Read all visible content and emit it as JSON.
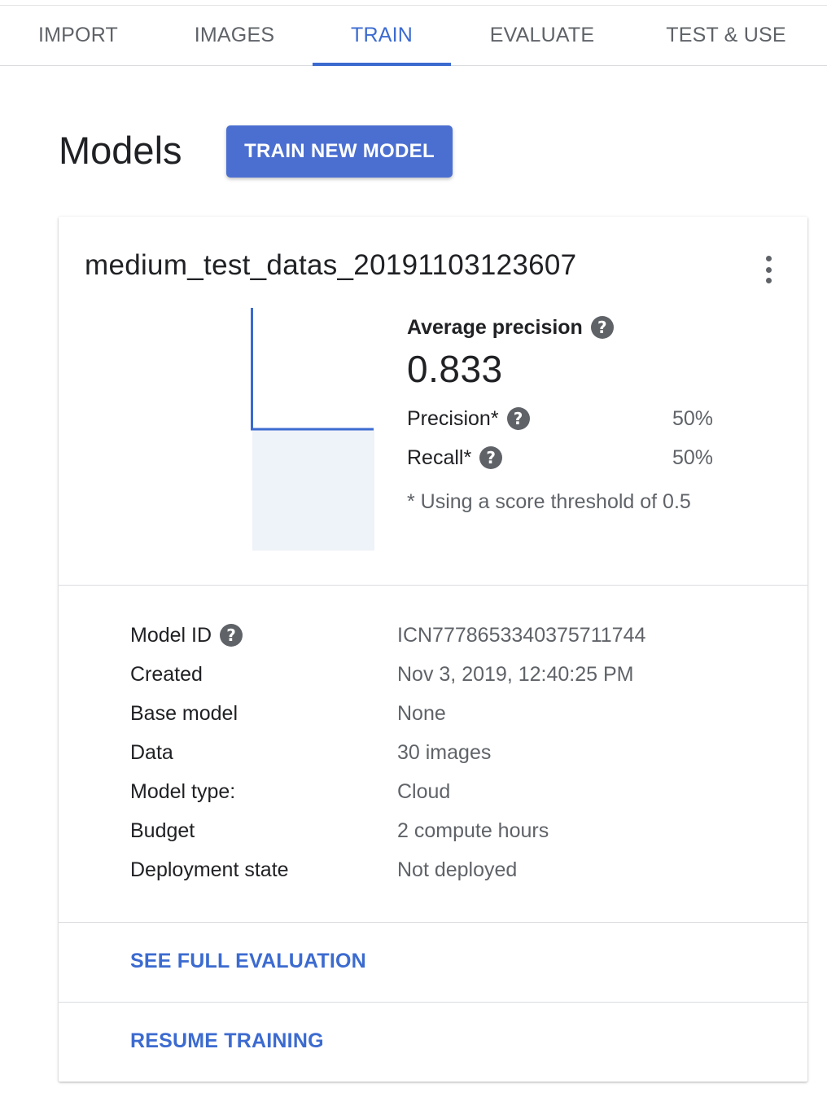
{
  "tabs": [
    {
      "label": "IMPORT"
    },
    {
      "label": "IMAGES"
    },
    {
      "label": "TRAIN"
    },
    {
      "label": "EVALUATE"
    },
    {
      "label": "TEST & USE"
    }
  ],
  "active_tab": "TRAIN",
  "header": {
    "title": "Models",
    "train_button_label": "TRAIN NEW MODEL"
  },
  "model": {
    "name": "medium_test_datas_20191103123607",
    "average_precision_label": "Average precision",
    "average_precision_value": "0.833",
    "precision_label": "Precision*",
    "precision_value": "50%",
    "recall_label": "Recall*",
    "recall_value": "50%",
    "threshold_note": "* Using a score threshold of 0.5",
    "details": [
      {
        "key": "Model ID",
        "value": "ICN7778653340375711744",
        "help": true
      },
      {
        "key": "Created",
        "value": "Nov 3, 2019, 12:40:25 PM"
      },
      {
        "key": "Base model",
        "value": "None"
      },
      {
        "key": "Data",
        "value": "30 images"
      },
      {
        "key": "Model type:",
        "value": "Cloud"
      },
      {
        "key": "Budget",
        "value": "2 compute hours"
      },
      {
        "key": "Deployment state",
        "value": "Not deployed"
      }
    ],
    "see_full_evaluation": "SEE FULL EVALUATION",
    "resume_training": "RESUME TRAINING"
  },
  "icons": {
    "help": "?",
    "more": "more-vert-icon"
  },
  "colors": {
    "accent": "#3c6bd0",
    "button": "#4b6fd1",
    "chart_line": "#3c6bd0",
    "chart_fill": "#eef2f9"
  }
}
